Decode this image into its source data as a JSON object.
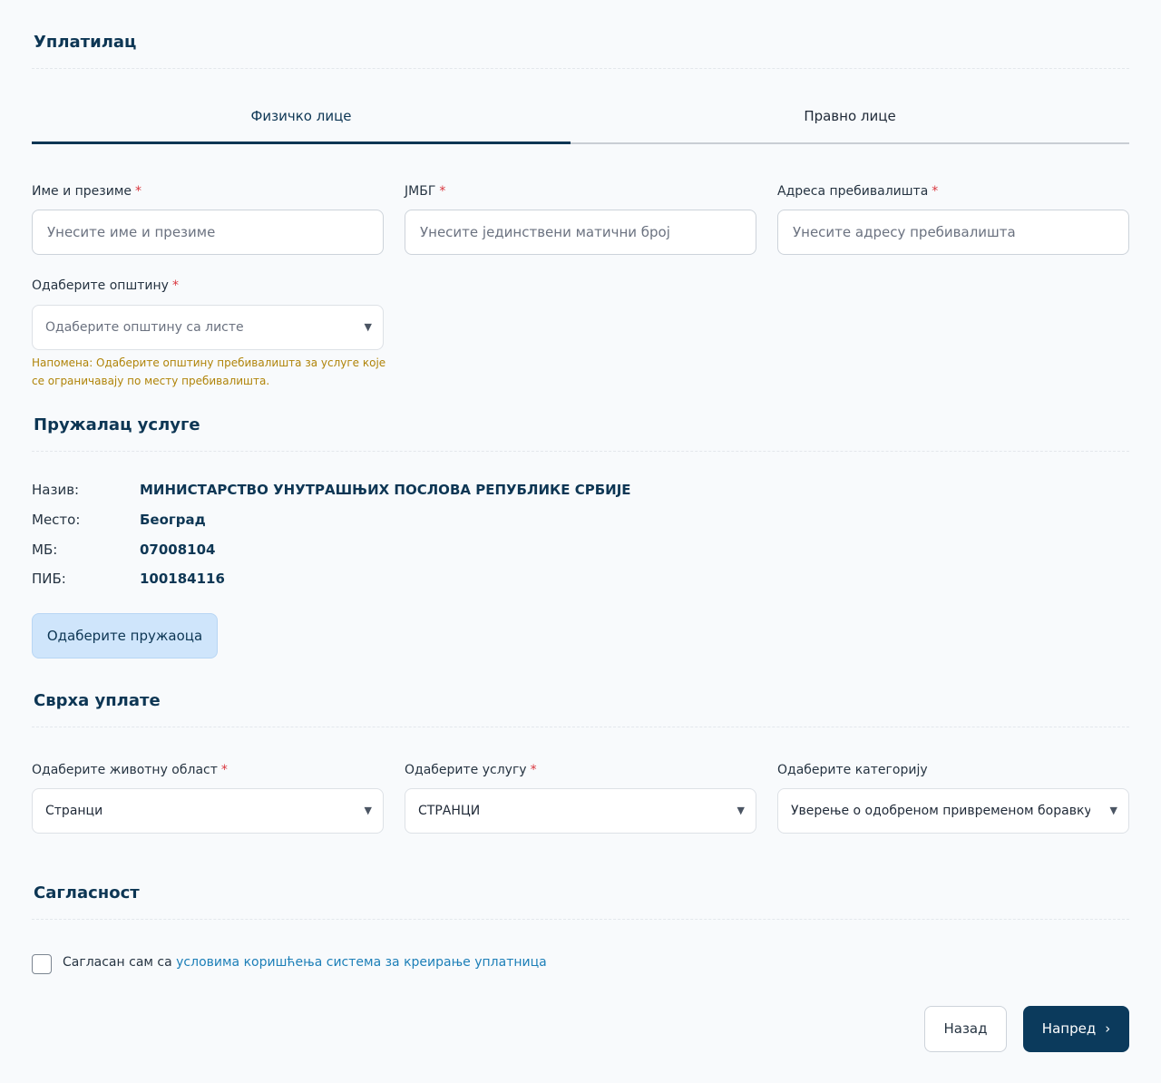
{
  "payer": {
    "title": "Уплатилац",
    "tabs": [
      {
        "label": "Физичко лице",
        "active": true
      },
      {
        "label": "Правно лице",
        "active": false
      }
    ],
    "fields": {
      "name": {
        "label": "Име и презиме",
        "required": "*",
        "placeholder": "Унесите име и презиме",
        "value": ""
      },
      "jmbg": {
        "label": "ЈМБГ",
        "required": "*",
        "placeholder": "Унесите јединствени матични број",
        "value": ""
      },
      "address": {
        "label": "Адреса пребивалишта",
        "required": "*",
        "placeholder": "Унесите адресу пребивалишта",
        "value": ""
      },
      "municipality": {
        "label": "Одаберите општину",
        "required": "*",
        "placeholder": "Одаберите општину са листе"
      }
    },
    "note": "Напомена: Одаберите општину пребивалишта за услуге које се ограничавају по месту пребивалишта."
  },
  "provider": {
    "title": "Пружалац услуге",
    "rows": [
      {
        "label": "Назив:",
        "value": "МИНИСТАРСТВО УНУТРАШЊИХ ПОСЛОВА РЕПУБЛИКЕ СРБИЈЕ"
      },
      {
        "label": "Место:",
        "value": "Београд"
      },
      {
        "label": "МБ:",
        "value": "07008104"
      },
      {
        "label": "ПИБ:",
        "value": "100184116"
      }
    ],
    "select_button": "Одаберите пружаоца"
  },
  "purpose": {
    "title": "Сврха уплате",
    "fields": {
      "area": {
        "label": "Одаберите животну област",
        "required": "*",
        "value": "Странци"
      },
      "service": {
        "label": "Одаберите услугу",
        "required": "*",
        "value": "СТРАНЦИ"
      },
      "category": {
        "label": "Одаберите категорију",
        "value": "Уверење о одобреном привременом боравку иностранца"
      }
    }
  },
  "consent": {
    "title": "Сагласност",
    "text": "Сагласан сам са ",
    "link": "условима коришћења система за креирање уплатница"
  },
  "nav": {
    "back": "Назад",
    "next": "Напред",
    "next_icon": "›"
  },
  "colors": {
    "primary": "#0b3a5c",
    "required": "#d9363e",
    "note": "#b08409",
    "link": "#1d7fb8",
    "provider_button": "#cfe5fb"
  }
}
